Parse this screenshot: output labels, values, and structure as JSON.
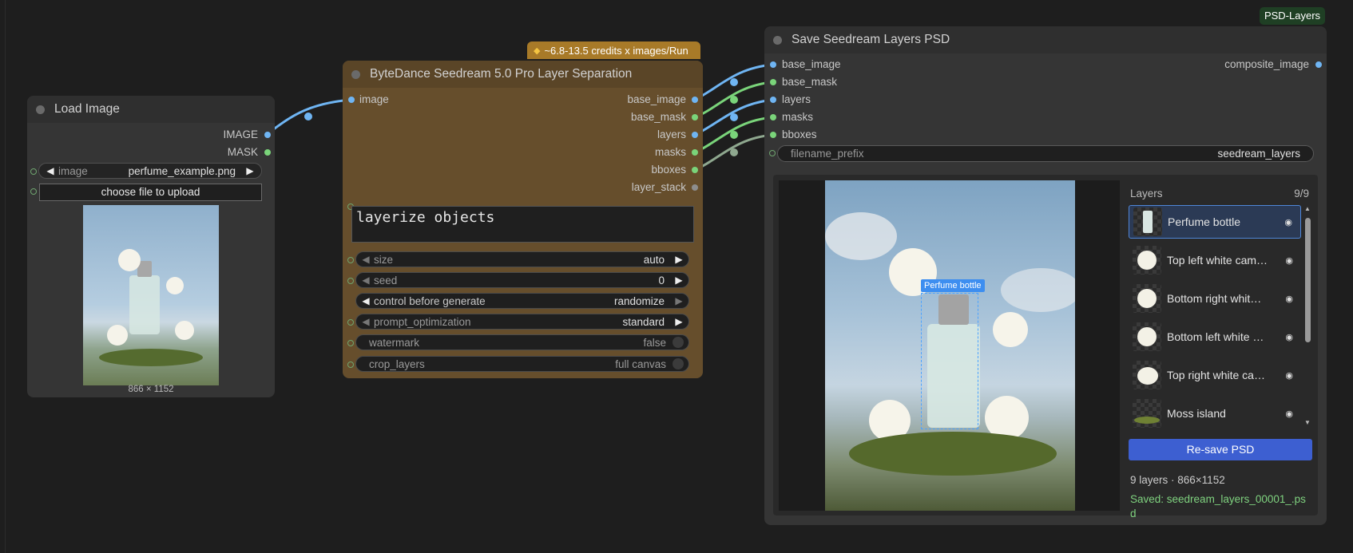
{
  "credits_badge": "~6.8-13.5 credits x images/Run",
  "psd_badge": "PSD-Layers",
  "load_image": {
    "title": "Load Image",
    "outputs": [
      "IMAGE",
      "MASK"
    ],
    "image_widget_name": "image",
    "image_widget_value": "perfume_example.png",
    "upload_button": "choose file to upload",
    "dimensions": "866 × 1152"
  },
  "seedream": {
    "title": "ByteDance Seedream 5.0 Pro Layer Separation",
    "input": "image",
    "outputs": [
      "base_image",
      "base_mask",
      "layers",
      "masks",
      "bboxes",
      "layer_stack"
    ],
    "prompt": "layerize objects",
    "widgets": [
      {
        "name": "size",
        "value": "auto"
      },
      {
        "name": "seed",
        "value": "0"
      },
      {
        "name": "control before generate",
        "value": "randomize"
      },
      {
        "name": "prompt_optimization",
        "value": "standard"
      },
      {
        "name": "watermark",
        "value": "false"
      },
      {
        "name": "crop_layers",
        "value": "full canvas"
      }
    ]
  },
  "save_psd": {
    "title": "Save Seedream Layers PSD",
    "inputs": [
      "base_image",
      "base_mask",
      "layers",
      "masks",
      "bboxes"
    ],
    "output": "composite_image",
    "filename_prefix_name": "filename_prefix",
    "filename_prefix_value": "seedream_layers",
    "bbox_label": "Perfume bottle",
    "layers_header": "Layers",
    "layers_count": "9/9",
    "layers": [
      {
        "name": "Perfume bottle"
      },
      {
        "name": "Top left white cam…"
      },
      {
        "name": "Bottom right whit…"
      },
      {
        "name": "Bottom left white …"
      },
      {
        "name": "Top right white ca…"
      },
      {
        "name": "Moss island"
      }
    ],
    "resave_button": "Re-save PSD",
    "info": "9 layers · 866×1152",
    "saved_line1": "Saved: seedream_layers_00001_.ps",
    "saved_line2": "d"
  },
  "colors": {
    "node_bg": "#353535",
    "seedream_bg": "#664e2c",
    "wire_blue": "#6fb5f3",
    "wire_green": "#7ad47a",
    "accent_button": "#3d5fd1",
    "saved_text": "#7fd27f"
  }
}
